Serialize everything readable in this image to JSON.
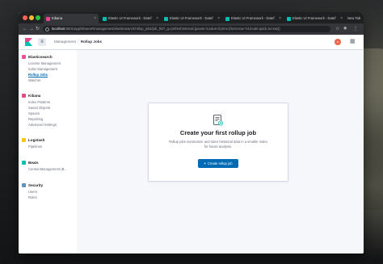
{
  "browser": {
    "tabs": [
      {
        "title": "Kibana",
        "active": true,
        "color": "#e8488b"
      },
      {
        "title": "Elastic UI Framework - Datef",
        "active": false,
        "color": "#00bfb3"
      },
      {
        "title": "Elastic UI Framework - Datef",
        "active": false,
        "color": "#00bfb3"
      },
      {
        "title": "Elastic UI Framework - Datef",
        "active": false,
        "color": "#00bfb3"
      },
      {
        "title": "Elastic UI Framework - Datef",
        "active": false,
        "color": "#00bfb3"
      },
      {
        "title": "New Tab",
        "active": false,
        "color": "#888888"
      }
    ],
    "url_host": "localhost",
    "url_path": ":5601/app/kibana#/management/elasticsearch/rollup_jobs/job_list?_g=(refreshInterval:(pause:!t,value:0),time:(from:now-7d,mode:quick,to:now))"
  },
  "header": {
    "breadcrumbs": [
      "Management",
      "Rollup Jobs"
    ],
    "avatar_initial": "e"
  },
  "sidebar": {
    "groups": [
      {
        "title": "Elasticsearch",
        "color": "#f04e98",
        "items": [
          "License Management",
          "Index Management",
          "Rollup Jobs",
          "Watcher"
        ]
      },
      {
        "title": "Kibana",
        "color": "#e8488b",
        "items": [
          "Index Patterns",
          "Saved Objects",
          "Spaces",
          "Reporting",
          "Advanced Settings"
        ]
      },
      {
        "title": "Logstash",
        "color": "#fec514",
        "items": [
          "Pipelines"
        ]
      },
      {
        "title": "Beats",
        "color": "#00bfb3",
        "items": [
          "Central Management (B..."
        ]
      },
      {
        "title": "Security",
        "color": "#6092c0",
        "items": [
          "Users",
          "Roles"
        ]
      }
    ],
    "selected": "Rollup Jobs"
  },
  "empty_prompt": {
    "title": "Create your first rollup job",
    "body": "Rollup jobs summarize and store historical data in a smaller index for future analysis.",
    "button_label": "Create rollup job",
    "button_icon": "+"
  },
  "colors": {
    "accent": "#006bb4"
  }
}
